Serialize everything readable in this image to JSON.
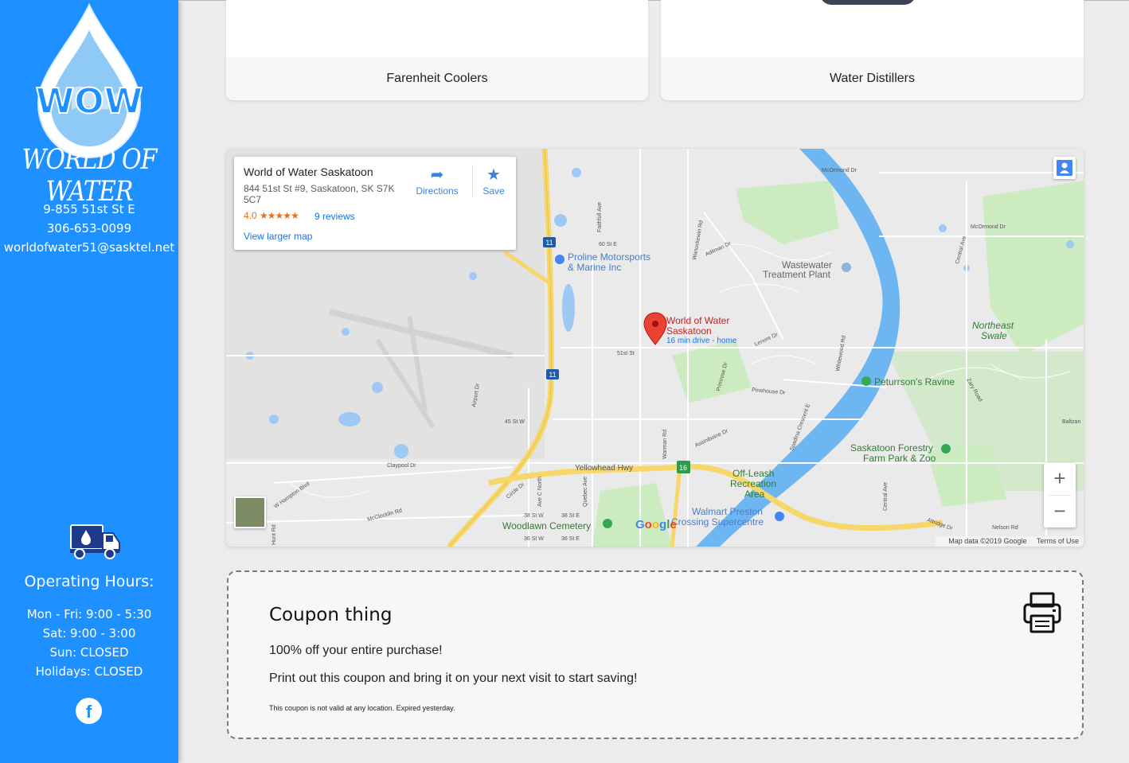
{
  "sidebar": {
    "brand": "WORLD OF WATER",
    "logo_text": "WOW",
    "address": "9-855 51st St E",
    "phone": "306-653-0099",
    "email": "worldofwater51@sasktel.net",
    "hours_title": "Operating Hours:",
    "hours": [
      "Mon - Fri: 9:00 - 5:30",
      "Sat: 9:00 - 3:00",
      "Sun: CLOSED",
      "Holidays: CLOSED"
    ],
    "icons": {
      "delivery": "truck-icon",
      "social": "facebook-icon"
    },
    "facebook_glyph": "f"
  },
  "products": [
    {
      "label": "Farenheit Coolers"
    },
    {
      "label": "Water Distillers"
    }
  ],
  "map": {
    "info": {
      "place_name": "World of Water Saskatoon",
      "address": "844 51st St #9, Saskatoon, SK S7K 5C7",
      "rating": "4.0",
      "stars": "★★★★★",
      "reviews": "9 reviews",
      "view_larger": "View larger map",
      "directions": "Directions",
      "save": "Save"
    },
    "marker": {
      "name_line1": "World of Water",
      "name_line2": "Saskatoon",
      "drive": "16 min drive - home"
    },
    "labels": {
      "proline1": "Proline Motorsports",
      "proline2": "& Marine Inc",
      "wastewater1": "Wastewater",
      "wastewater2": "Treatment Plant",
      "northeast1": "Northeast",
      "northeast2": "Swale",
      "peturrson": "Peturrson's Ravine",
      "forestry1": "Saskatoon Forestry",
      "forestry2": "Farm Park & Zoo",
      "offleash1": "Off-Leash",
      "offleash2": "Recreation",
      "offleash3": "Area",
      "walmart1": "Walmart Preston",
      "walmart2": "Crossing Supercentre",
      "woodlawn": "Woodlawn Cemetery",
      "yellowhead": "Yellowhead Hwy",
      "circle": "Circle Dr",
      "claypool": "Claypool Dr",
      "st60": "60 St E",
      "st51": "51st St",
      "st45": "45 St W",
      "st38w": "38 St W",
      "st38e": "38 St E",
      "st36w": "36 St W",
      "st36e": "36 St E",
      "pinehouse": "Pinehouse Dr",
      "mcormond": "McOrmond Dr",
      "lenore": "Lenore Dr",
      "adilman": "Adilman Dr",
      "primrose": "Primrose Dr",
      "assiniboine": "Assiniboine Dr",
      "warman": "Warman Rd",
      "faithfull": "Faithfull Ave",
      "central": "Central Ave",
      "airport": "Airport Dr",
      "whitewood": "Whitewood Rd",
      "wanuskewin": "Wanuskewin Rd",
      "hampton": "W Hampton Blvd",
      "mcclocklin": "McClocklin Rd",
      "hunt": "Hunt Rd",
      "quebec": "Quebec Ave",
      "avec": "Ave C North",
      "nelson": "Nelson Rd",
      "attridge": "Attridge Dr",
      "baltzan": "Baltzan",
      "zary": "Zary Road",
      "spadina": "Spadina Crescent E",
      "hwy11": "11",
      "hwy16": "16"
    },
    "google": "Google",
    "map_data": "Map data ©2019 Google",
    "terms": "Terms of Use",
    "zoom_in": "+",
    "zoom_out": "−"
  },
  "coupon": {
    "title": "Coupon thing",
    "line1": "100% off your entire purchase!",
    "line2": "Print out this coupon and bring it on your next visit to start saving!",
    "fine_print": "This coupon is not valid at any location. Expired yesterday.",
    "icon": "printer-icon"
  },
  "colors": {
    "sidebar": "#1e90ff",
    "page_bg": "#ececec",
    "map_park": "#cdebc0",
    "map_water": "#6db6f2",
    "map_highway": "#f7d769",
    "rating": "#e7711b",
    "link": "#1a73e8"
  }
}
